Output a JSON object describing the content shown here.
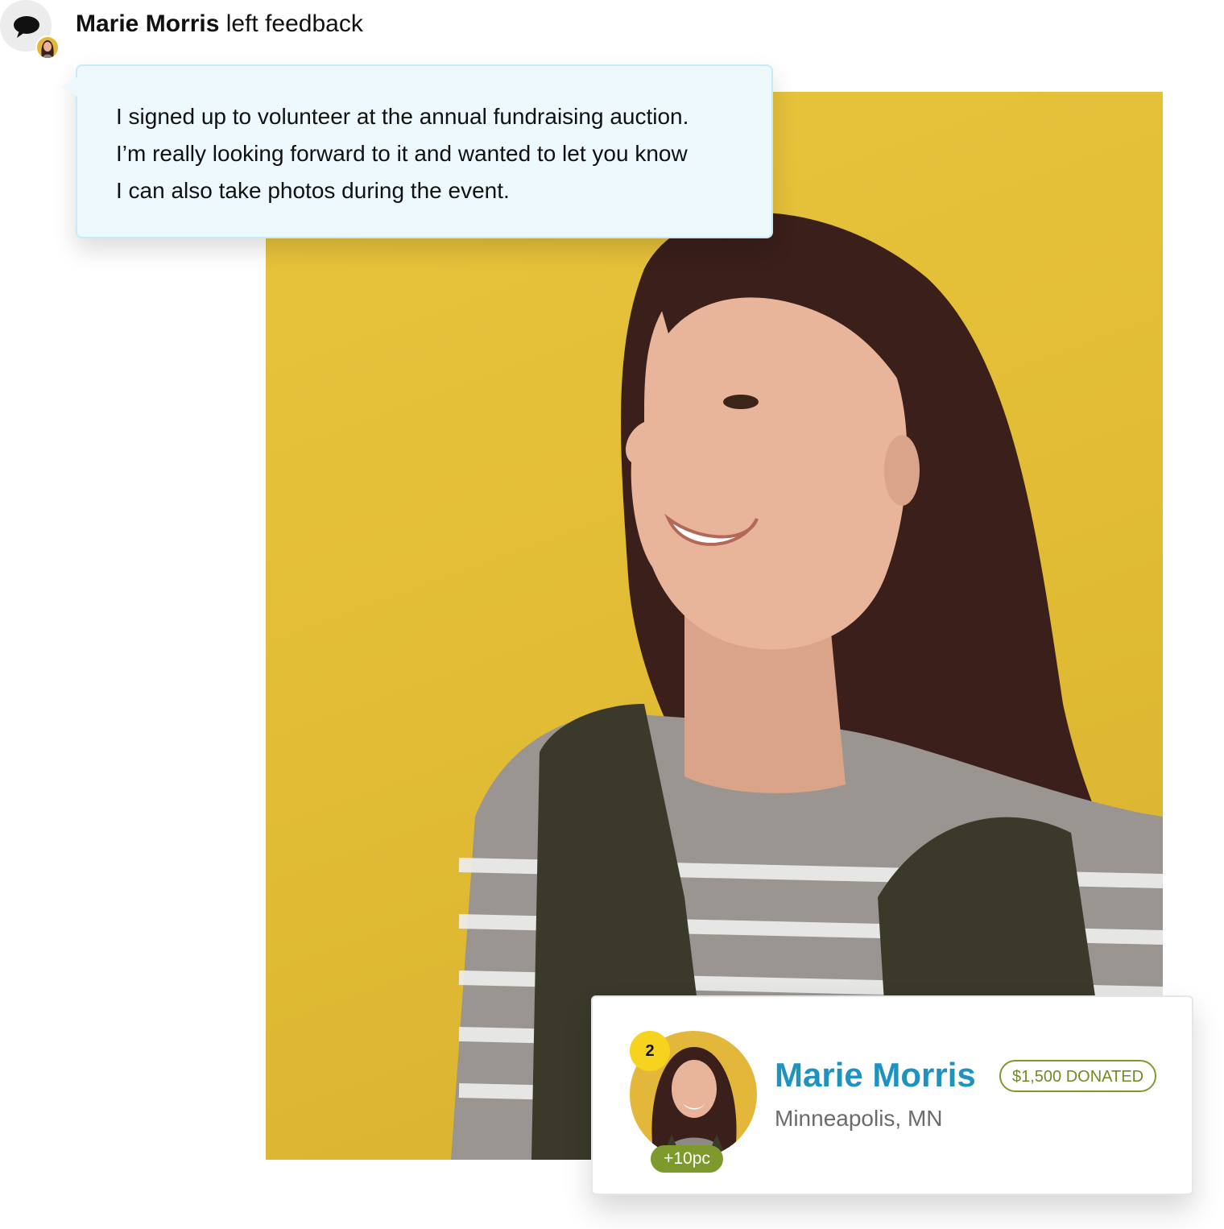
{
  "feedback": {
    "author_name": "Marie Morris",
    "action_text": " left feedback",
    "message_lines": [
      "I signed up to volunteer at the annual fundraising auction.",
      "I’m really looking forward to it and wanted to let you know",
      "I can also take photos during the event."
    ]
  },
  "profile": {
    "name": "Marie Morris",
    "location": "Minneapolis, MN",
    "rank": "2",
    "points": "+10pc",
    "donated_label": "$1,500 DONATED"
  },
  "colors": {
    "photo_background": "#e2bd35",
    "bubble_background": "#eef9fe",
    "name_accent": "#1e93bf",
    "donated_green": "#7f9a2c",
    "rank_yellow": "#f6d31f"
  }
}
